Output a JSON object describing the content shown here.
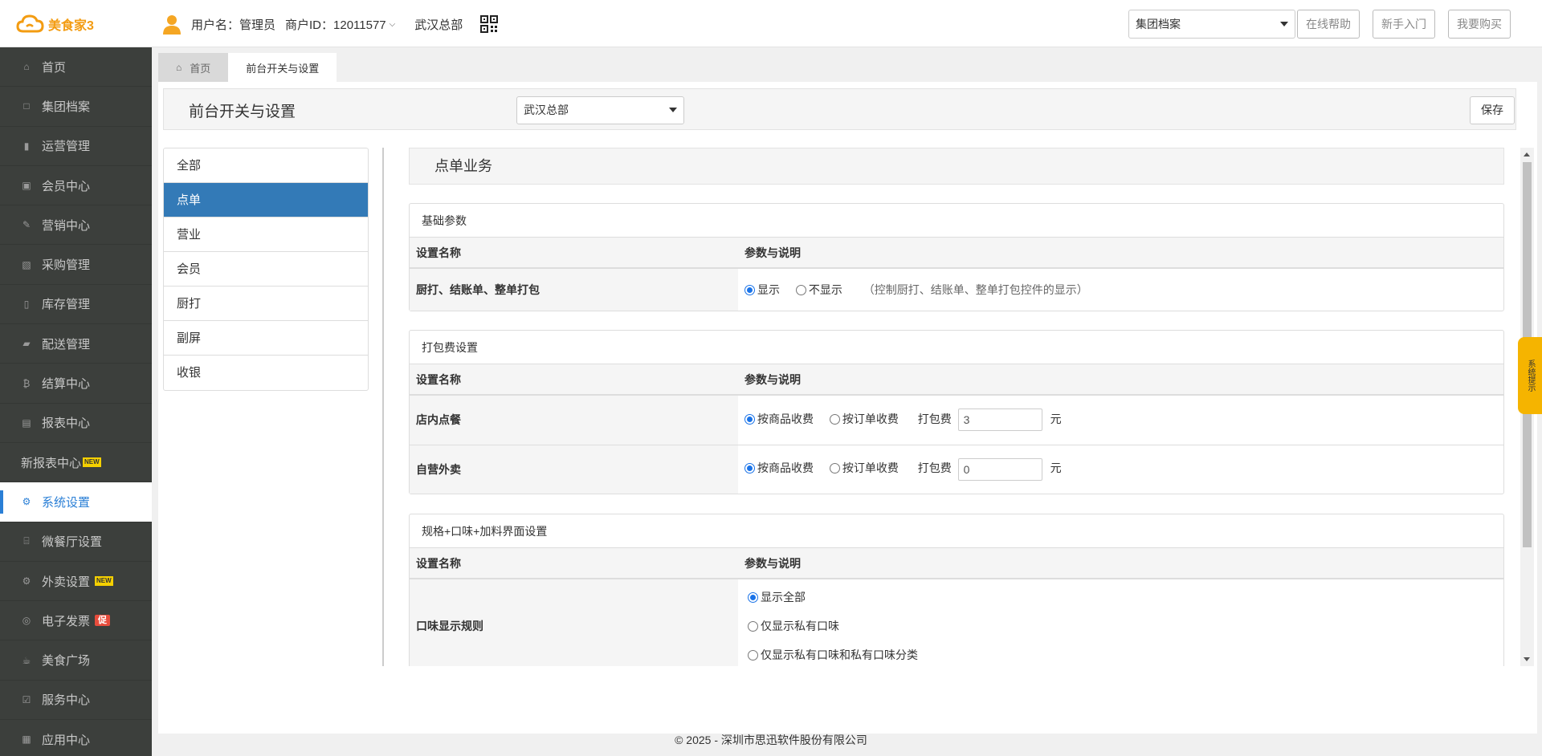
{
  "header": {
    "logo_text": "美食家3",
    "user_label": "用户名：管理员",
    "merchant_label": "商户ID：12011577",
    "store_name": "武汉总部",
    "group_select": "集团档案",
    "buttons": [
      "在线帮助",
      "新手入门",
      "我要购买"
    ]
  },
  "sidebar": {
    "items": [
      {
        "label": "首页",
        "icon": "home-icon"
      },
      {
        "label": "集团档案",
        "icon": "file-icon"
      },
      {
        "label": "运营管理",
        "icon": "bar-chart-icon"
      },
      {
        "label": "会员中心",
        "icon": "id-card-icon"
      },
      {
        "label": "营销中心",
        "icon": "edit-icon"
      },
      {
        "label": "采购管理",
        "icon": "book-icon"
      },
      {
        "label": "库存管理",
        "icon": "tablet-icon"
      },
      {
        "label": "配送管理",
        "icon": "truck-icon"
      },
      {
        "label": "结算中心",
        "icon": "bitcoin-icon"
      },
      {
        "label": "报表中心",
        "icon": "report-icon"
      },
      {
        "label": "新报表中心",
        "icon": "",
        "badge": "NEW"
      },
      {
        "label": "系统设置",
        "icon": "gears-icon",
        "active": true
      },
      {
        "label": "微餐厅设置",
        "icon": "cutlery-icon"
      },
      {
        "label": "外卖设置",
        "icon": "gear-icon",
        "badge": "NEW"
      },
      {
        "label": "电子发票",
        "icon": "circle-icon",
        "badge_cu": "促"
      },
      {
        "label": "美食广场",
        "icon": "coffee-icon"
      },
      {
        "label": "服务中心",
        "icon": "checkbox-icon"
      },
      {
        "label": "应用中心",
        "icon": "grid-icon"
      }
    ]
  },
  "tabs": [
    {
      "label": "首页",
      "current": false
    },
    {
      "label": "前台开关与设置",
      "current": true
    }
  ],
  "page": {
    "title": "前台开关与设置",
    "store_select": "武汉总部",
    "save_label": "保存"
  },
  "categories": [
    {
      "label": "全部",
      "active": false
    },
    {
      "label": "点单",
      "active": true
    },
    {
      "label": "营业",
      "active": false
    },
    {
      "label": "会员",
      "active": false
    },
    {
      "label": "厨打",
      "active": false
    },
    {
      "label": "副屏",
      "active": false
    },
    {
      "label": "收银",
      "active": false
    }
  ],
  "section_title": "点单业务",
  "col_headers": {
    "name": "设置名称",
    "desc": "参数与说明"
  },
  "cards": {
    "basic": {
      "title": "基础参数",
      "row_name": "厨打、结账单、整单打包",
      "opt_show": "显示",
      "opt_hide": "不显示",
      "hint": "（控制厨打、结账单、整单打包控件的显示）"
    },
    "packing": {
      "title": "打包费设置",
      "rows": [
        {
          "name": "店内点餐",
          "opt_item": "按商品收费",
          "opt_order": "按订单收费",
          "fee_label": "打包费",
          "fee": "3",
          "unit": "元"
        },
        {
          "name": "自营外卖",
          "opt_item": "按商品收费",
          "opt_order": "按订单收费",
          "fee_label": "打包费",
          "fee": "0",
          "unit": "元"
        }
      ]
    },
    "spec": {
      "title": "规格+口味+加料界面设置",
      "row_name": "口味显示规则",
      "options": [
        "显示全部",
        "仅显示私有口味",
        "仅显示私有口味和私有口味分类"
      ]
    }
  },
  "side_tip": "系统提示",
  "footer": "© 2025 - 深圳市思迅软件股份有限公司",
  "colors": {
    "accent": "#337ab7",
    "sidebar_bg": "#3c3f3c",
    "logo": "#f39c12",
    "tip": "#f5b400"
  }
}
